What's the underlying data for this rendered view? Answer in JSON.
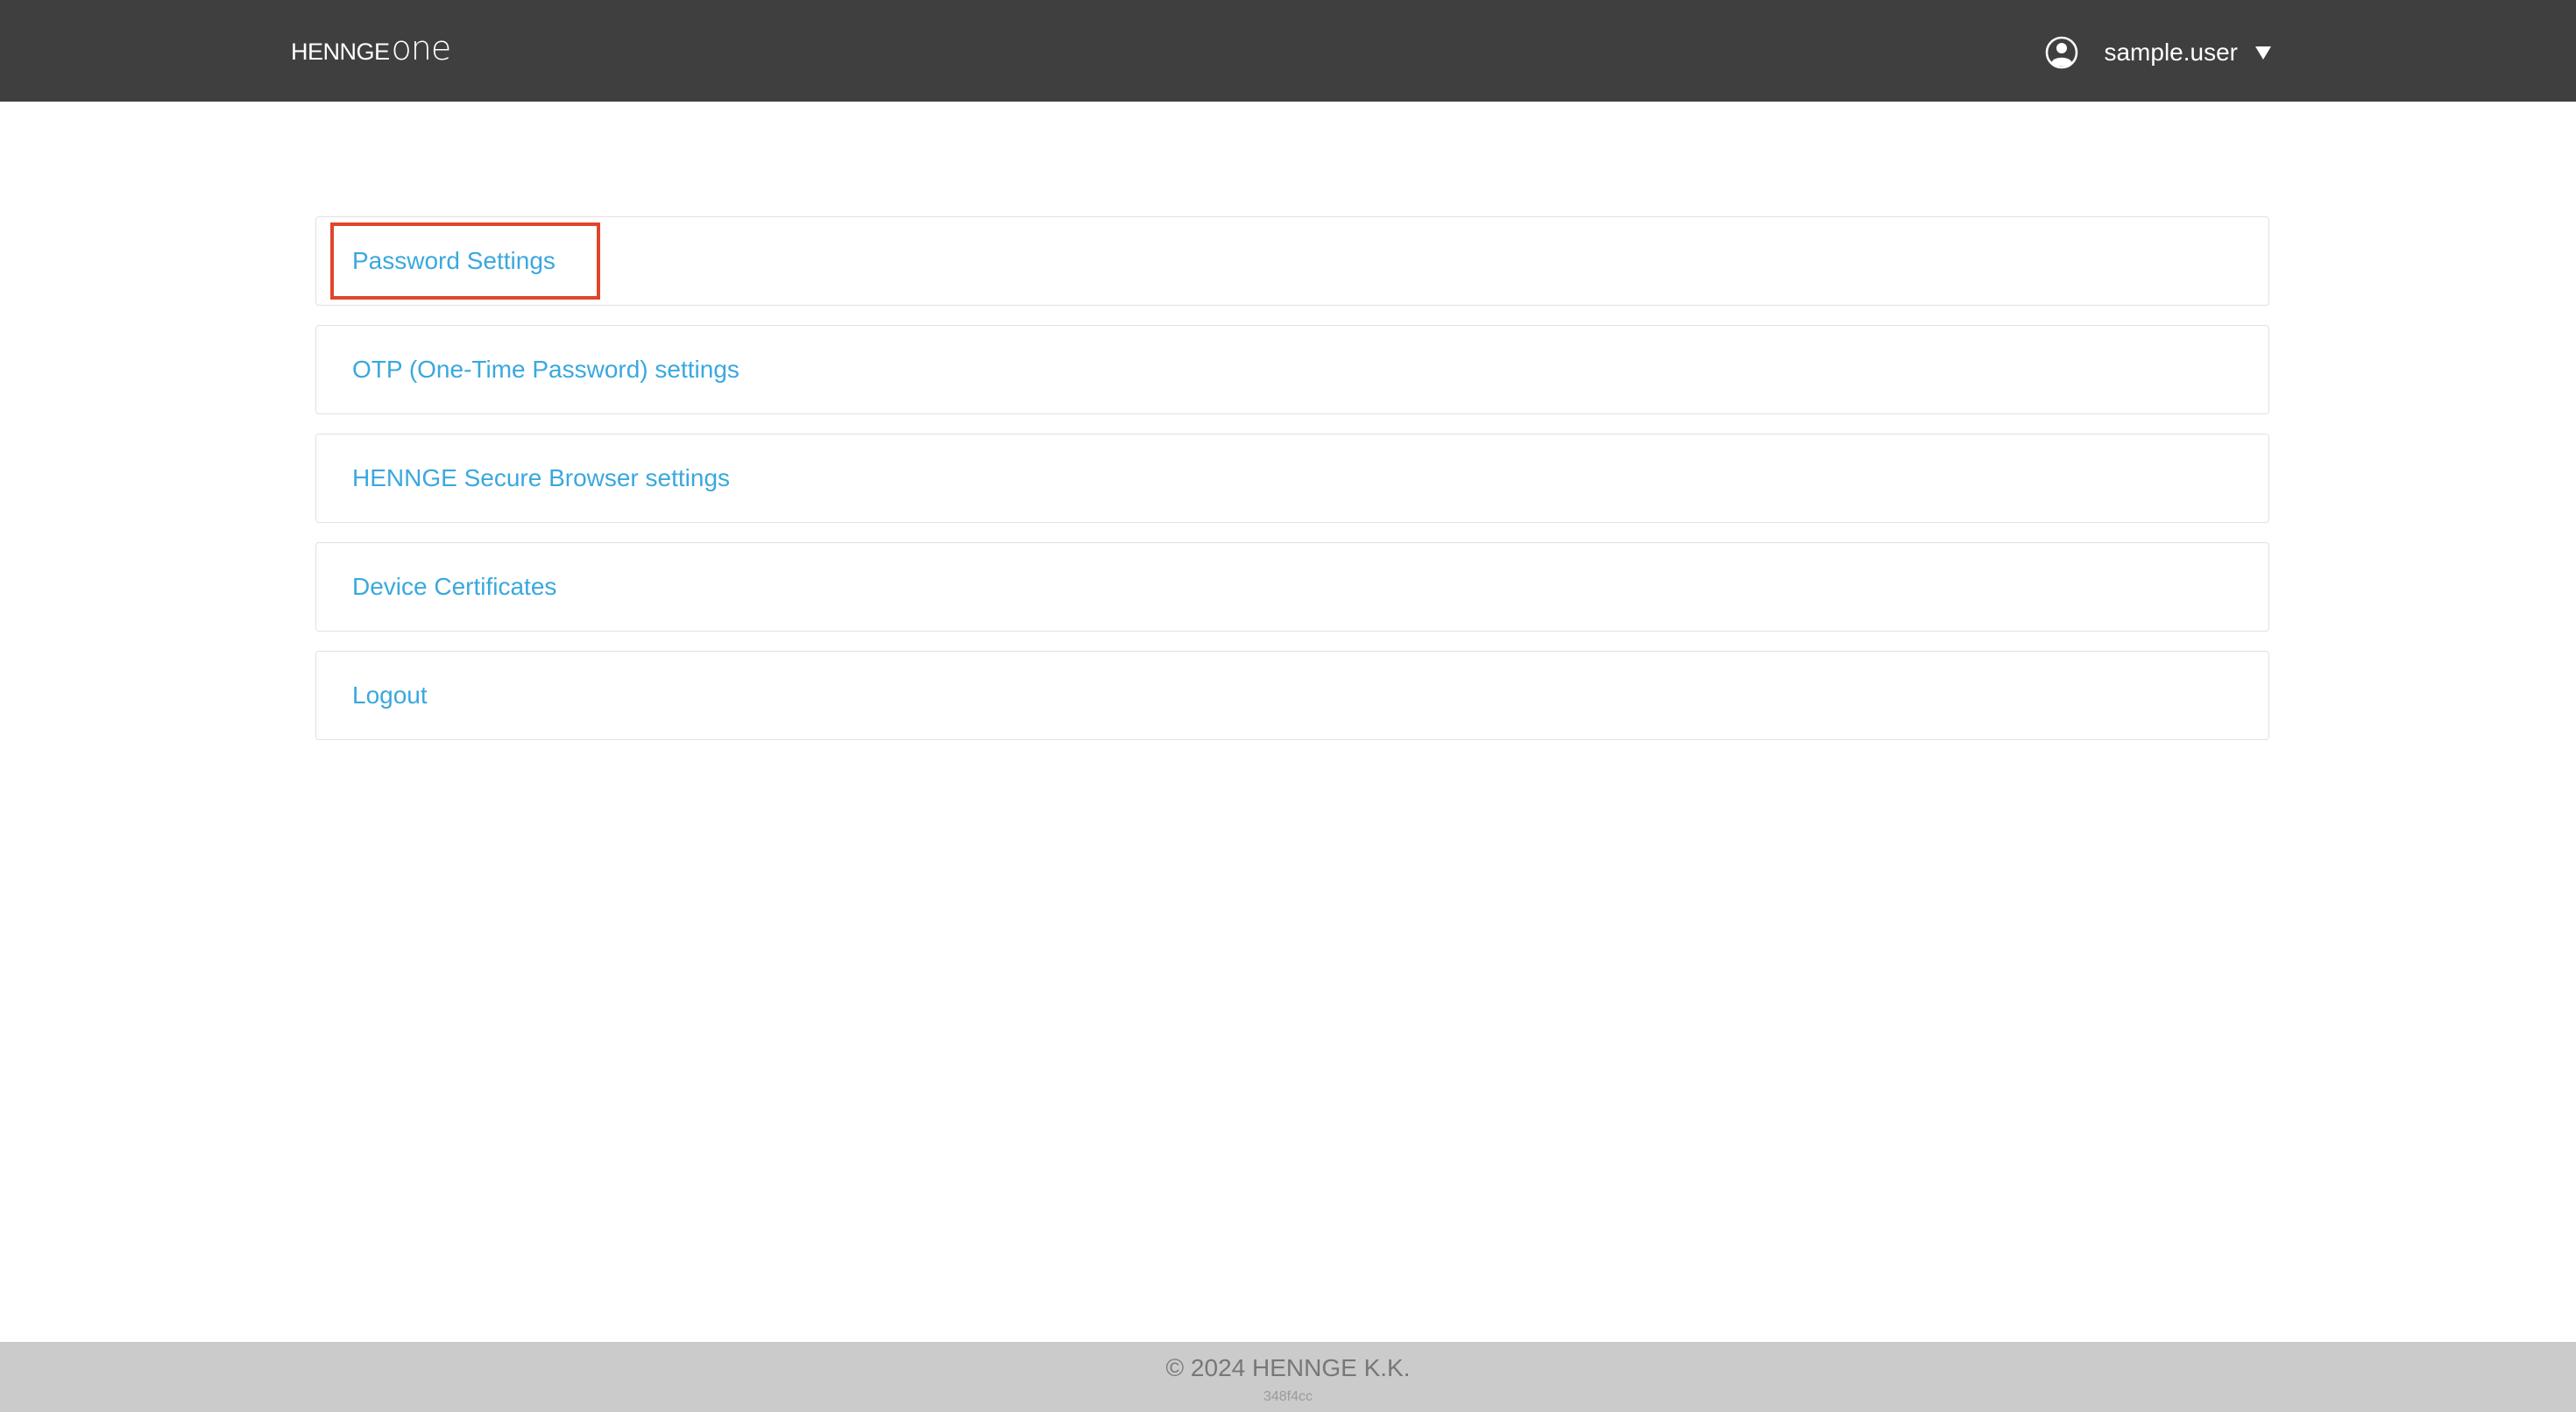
{
  "header": {
    "logo_main": "HENNGE",
    "logo_suffix": "one",
    "user_name": "sample.user",
    "user_icon": "user-circle-icon",
    "dropdown_icon": "caret-down-icon"
  },
  "menu": {
    "items": [
      {
        "label": "Password Settings",
        "highlighted": true
      },
      {
        "label": "OTP (One-Time Password) settings"
      },
      {
        "label": "HENNGE Secure Browser settings"
      },
      {
        "label": "Device Certificates"
      },
      {
        "label": "Logout"
      }
    ]
  },
  "footer": {
    "copyright": "© 2024 HENNGE K.K.",
    "build": "348f4cc"
  },
  "colors": {
    "header_bg": "#3f3f3f",
    "link": "#3aa8de",
    "highlight": "#e0452b",
    "footer_bg": "#cbcbcb"
  }
}
